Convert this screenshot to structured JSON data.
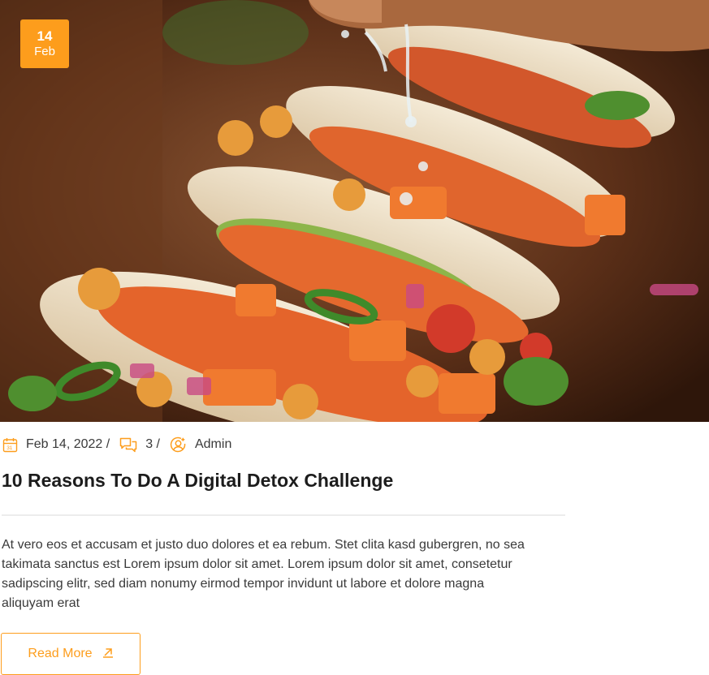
{
  "post": {
    "date_badge": {
      "day": "14",
      "month": "Feb"
    },
    "meta": {
      "date": "Feb 14, 2022 /",
      "comments": "3 /",
      "author": "Admin"
    },
    "title": "10 Reasons To Do A Digital Detox Challenge",
    "excerpt": "At vero eos et accusam et justo duo dolores et ea rebum. Stet clita kasd gubergren, no sea takimata sanctus est Lorem ipsum dolor sit amet. Lorem ipsum dolor sit amet, consetetur sadipscing elitr, sed diam nonumy eirmod tempor invidunt ut labore et dolore magna aliquyam erat",
    "read_more_label": "Read More"
  },
  "colors": {
    "accent": "#fd9d1c",
    "text": "#1c1c1c",
    "body_text": "#3a3a3a",
    "divider": "#ececec"
  },
  "icons": [
    "calendar-icon",
    "comments-icon",
    "user-icon",
    "arrow-up-right-icon"
  ]
}
